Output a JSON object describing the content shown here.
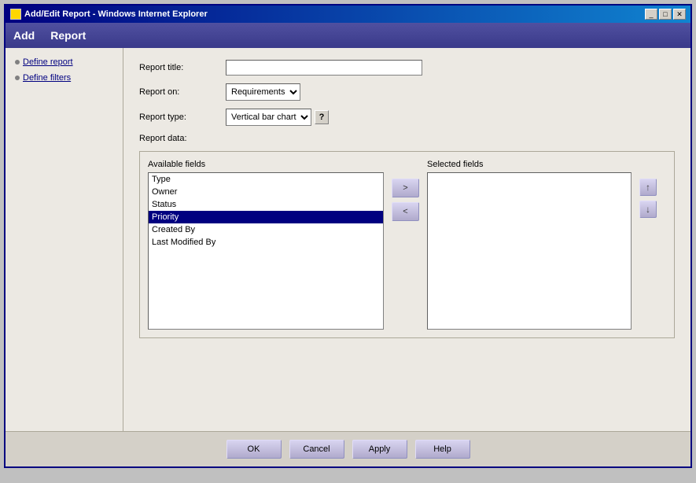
{
  "window": {
    "title": "Add/Edit Report - Windows Internet Explorer",
    "title_icon": "ie-icon"
  },
  "title_btns": {
    "minimize": "_",
    "maximize": "□",
    "close": "✕"
  },
  "menu": {
    "add_label": "Add",
    "report_label": "Report"
  },
  "sidebar": {
    "items": [
      {
        "id": "define-report",
        "label": "Define report"
      },
      {
        "id": "define-filters",
        "label": "Define filters"
      }
    ]
  },
  "form": {
    "report_title_label": "Report title:",
    "report_title_value": "",
    "report_on_label": "Report on:",
    "report_on_value": "Requirements",
    "report_on_options": [
      "Requirements"
    ],
    "report_type_label": "Report type:",
    "report_type_value": "Vertical bar chart",
    "report_type_options": [
      "Vertical bar chart"
    ],
    "report_data_label": "Report data:"
  },
  "fields": {
    "available_label": "Available fields",
    "selected_label": "Selected fields",
    "available_items": [
      {
        "id": "type",
        "label": "Type",
        "selected": false
      },
      {
        "id": "owner",
        "label": "Owner",
        "selected": false
      },
      {
        "id": "status",
        "label": "Status",
        "selected": false
      },
      {
        "id": "priority",
        "label": "Priority",
        "selected": true
      },
      {
        "id": "created-by",
        "label": "Created By",
        "selected": false
      },
      {
        "id": "last-modified-by",
        "label": "Last Modified By",
        "selected": false
      }
    ],
    "selected_items": []
  },
  "transfer_btns": {
    "add": ">",
    "remove": "<"
  },
  "order_btns": {
    "up": "↑",
    "down": "↓"
  },
  "buttons": {
    "ok": "OK",
    "cancel": "Cancel",
    "apply": "Apply",
    "help": "Help"
  }
}
